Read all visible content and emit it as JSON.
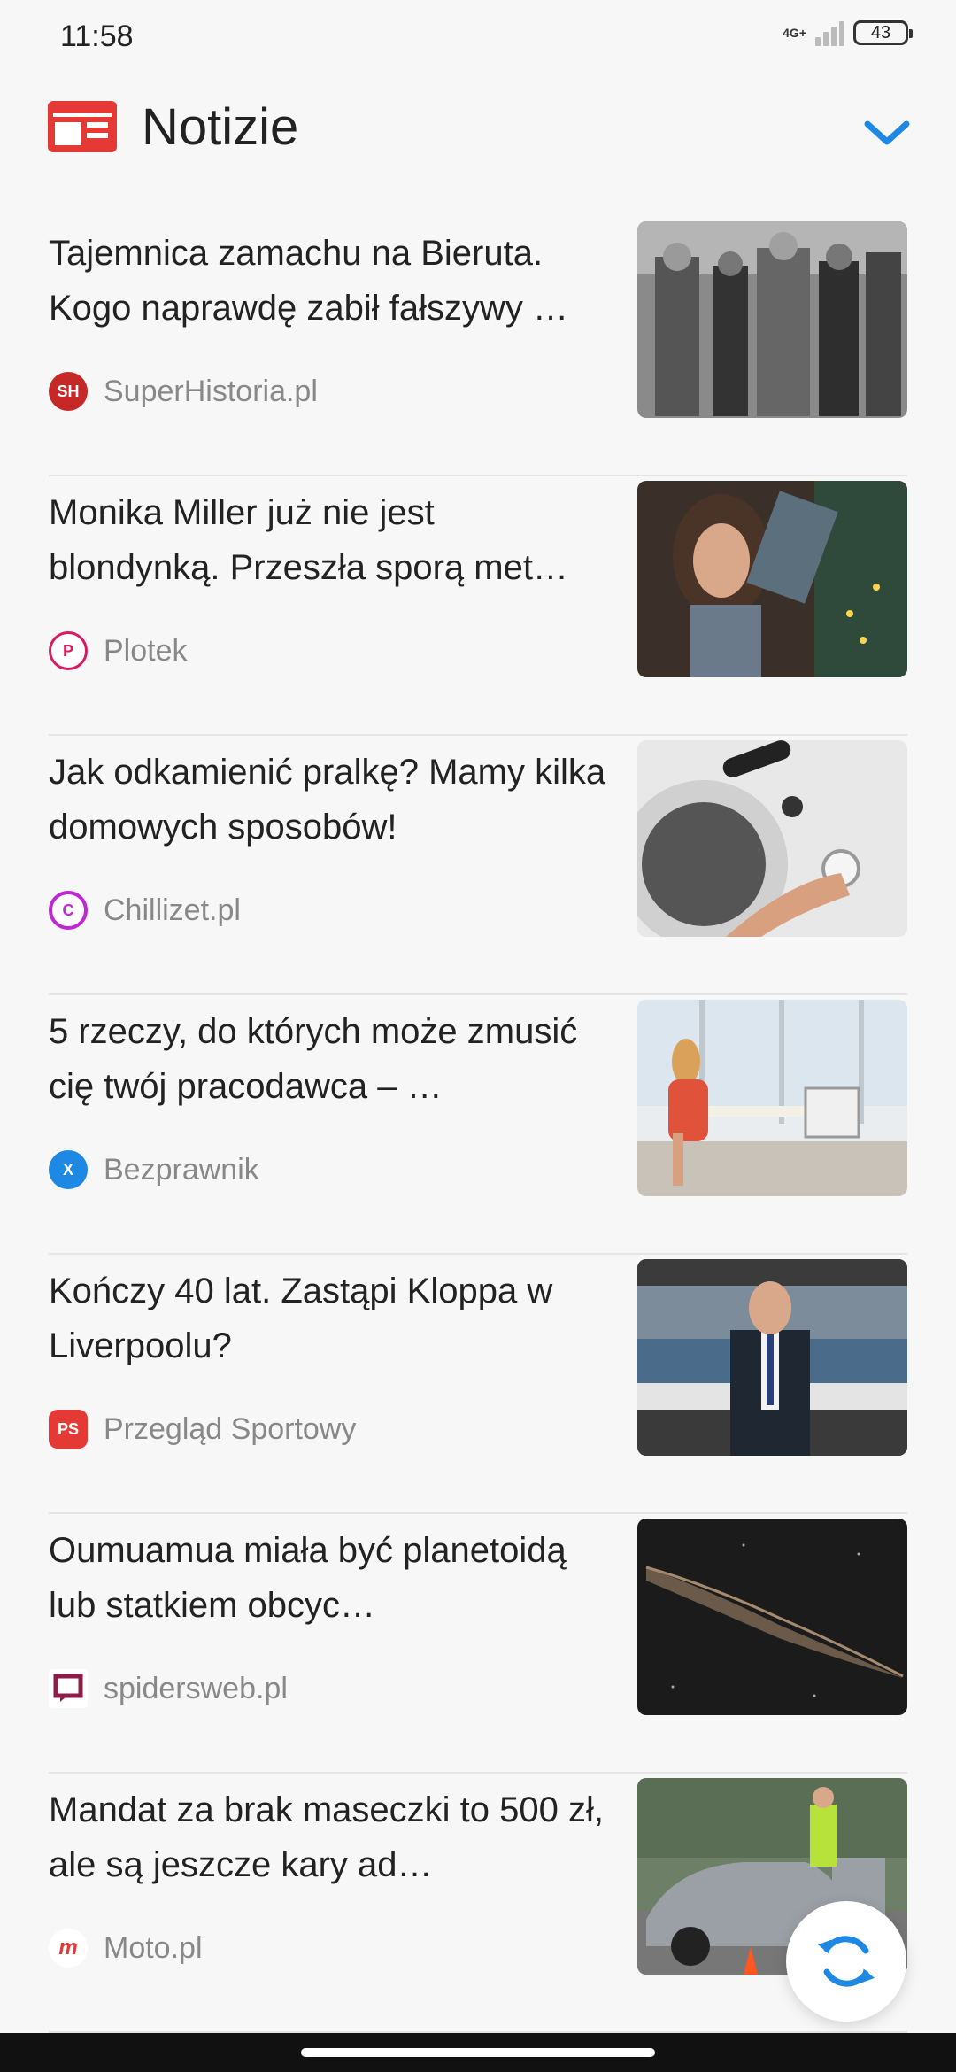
{
  "status_bar": {
    "time": "11:58",
    "network": "4G+",
    "battery": "43"
  },
  "header": {
    "title": "Notizie",
    "icon": "news-icon",
    "accent": "#e53935",
    "chevron_color": "#1e88e5"
  },
  "news": [
    {
      "title": "Tajemnica zamachu na Bieruta. Kogo naprawdę zabił fałszywy …",
      "source": "SuperHistoria.pl",
      "logo_text": "SH",
      "logo_color": "#c62828"
    },
    {
      "title": "Monika Miller już nie jest blondynką. Przeszła sporą met…",
      "source": "Plotek",
      "logo_text": "P",
      "logo_color": "#d81b60"
    },
    {
      "title": "Jak odkamienić pralkę? Mamy kilka domowych sposobów!",
      "source": "Chillizet.pl",
      "logo_text": "C",
      "logo_color": "#c026d3"
    },
    {
      "title": "5 rzeczy, do których może zmusić cię twój pracodawca – …",
      "source": "Bezprawnik",
      "logo_text": "X",
      "logo_color": "#1e88e5"
    },
    {
      "title": "Kończy 40 lat. Zastąpi Kloppa w Liverpoolu?",
      "source": "Przegląd Sportowy",
      "logo_text": "PS",
      "logo_color": "#e53935"
    },
    {
      "title": "Oumuamua miała być planetoidą lub statkiem obcyc…",
      "source": "spidersweb.pl",
      "logo_text": "",
      "logo_color": "#8e1b4a"
    },
    {
      "title": "Mandat za brak maseczki to 500 zł, ale są jeszcze kary ad…",
      "source": "Moto.pl",
      "logo_text": "m",
      "logo_color": "#e53935"
    }
  ]
}
